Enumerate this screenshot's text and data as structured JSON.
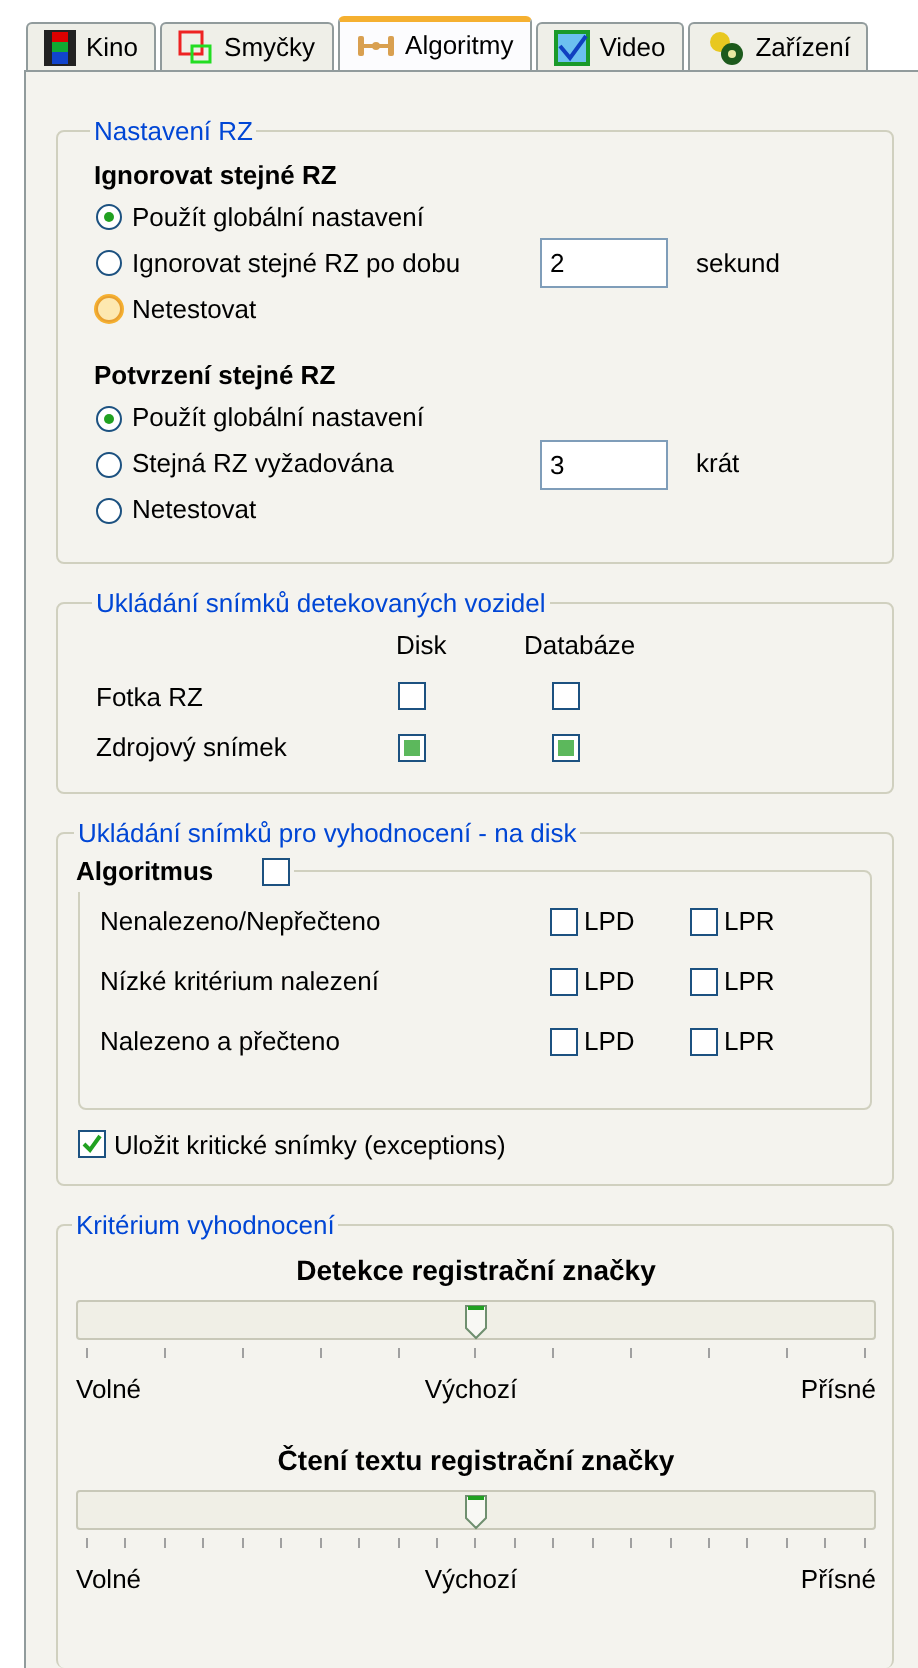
{
  "tabs": [
    {
      "label": "Kino",
      "selected": false
    },
    {
      "label": "Smyčky",
      "selected": false
    },
    {
      "label": "Algoritmy",
      "selected": true
    },
    {
      "label": "Video",
      "selected": false
    },
    {
      "label": "Zařízení",
      "selected": false
    }
  ],
  "plate_settings": {
    "title": "Nastavení RZ",
    "sections": [
      {
        "heading": "Ignorovat stejné RZ",
        "options": [
          {
            "label": "Použít globální nastavení",
            "selected": true,
            "hovered": false
          },
          {
            "label": "Ignorovat stejné RZ po dobu",
            "selected": false,
            "hovered": false,
            "value": "2",
            "unit": "sekund"
          },
          {
            "label": "Netestovat",
            "selected": false,
            "hovered": true
          }
        ]
      },
      {
        "heading": "Potvrzení stejné RZ",
        "options": [
          {
            "label": "Použít globální nastavení",
            "selected": true,
            "hovered": false
          },
          {
            "label": "Stejná RZ vyžadována",
            "selected": false,
            "hovered": false,
            "value": "3",
            "unit": "krát"
          },
          {
            "label": "Netestovat",
            "selected": false,
            "hovered": false
          }
        ]
      }
    ]
  },
  "vehicle_images": {
    "title": "Ukládání snímků detekovaných vozidel",
    "columns": [
      "Disk",
      "Databáze"
    ],
    "rows": [
      {
        "label": "Fotka RZ",
        "checks": [
          false,
          false
        ]
      },
      {
        "label": "Zdrojový snímek",
        "checks": [
          true,
          true
        ]
      }
    ]
  },
  "evaluation_images": {
    "title": "Ukládání snímků pro vyhodnocení - na disk",
    "algorithm": {
      "label": "Algoritmus",
      "checked": false
    },
    "rows": [
      {
        "label": "Nenalezeno/Nepřečteno",
        "options": [
          {
            "label": "LPD",
            "checked": false
          },
          {
            "label": "LPR",
            "checked": false
          }
        ]
      },
      {
        "label": "Nízké kritérium nalezení",
        "options": [
          {
            "label": "LPD",
            "checked": false
          },
          {
            "label": "LPR",
            "checked": false
          }
        ]
      },
      {
        "label": "Nalezeno a přečteno",
        "options": [
          {
            "label": "LPD",
            "checked": false
          },
          {
            "label": "LPR",
            "checked": false
          }
        ]
      }
    ],
    "exceptions": {
      "label": "Uložit kritické snímky (exceptions)",
      "checked": true
    }
  },
  "criteria": {
    "title": "Kritérium vyhodnocení",
    "sliders": [
      {
        "title": "Detekce registrační značky",
        "level": 0.5,
        "labels": [
          "Volné",
          "Výchozí",
          "Přísné"
        ]
      },
      {
        "title": "Čtení textu registrační značky",
        "level": 0.5,
        "labels": [
          "Volné",
          "Výchozí",
          "Přísné"
        ]
      }
    ]
  }
}
